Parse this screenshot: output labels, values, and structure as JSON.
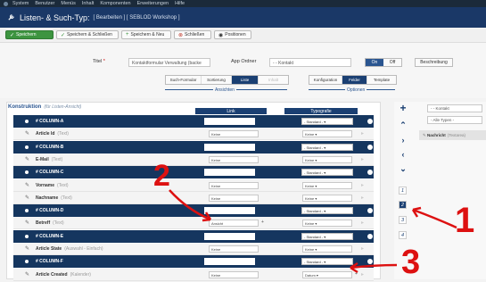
{
  "menu": [
    "System",
    "Benutzer",
    "Menüs",
    "Inhalt",
    "Komponenten",
    "Erweiterungen",
    "Hilfe"
  ],
  "title": {
    "main": "Listen- & Such-Typ:",
    "sub": "[ Bearbeiten ] [ SEBLOD Workshop ]"
  },
  "toolbar": {
    "save": "Speichern",
    "save_close": "Speichern & Schließen",
    "save_new": "Speichern & Neu",
    "close": "Schließen",
    "positions": "Positionen"
  },
  "form": {
    "title_label": "Titel",
    "title_req": "*",
    "title_value": "Kontaktformular Verwaltung (backe",
    "app_label": "App Ordner",
    "app_value": "- - Kontakt",
    "toggle_on": "On",
    "toggle_off": "Off",
    "description": "Beschreibung",
    "views": [
      "Such-Formular",
      "Sortierung",
      "Liste",
      "Inhalt"
    ],
    "views_label": "Ansichten",
    "options": [
      "Konfiguration",
      "Felder",
      "Template"
    ],
    "options_label": "Optionen"
  },
  "section": {
    "title": "Konstruktion",
    "hint": "(für Listen-Ansicht)",
    "col_link": "Link",
    "col_typo": "Typografie"
  },
  "rows": [
    {
      "name": "# COLUMN-A",
      "type": "",
      "dark": true,
      "link": "",
      "typo": "- Standard -"
    },
    {
      "name": "Article Id",
      "type": "(Text)",
      "dark": false,
      "link": "Keine",
      "typo": "Keine"
    },
    {
      "name": "# COLUMN-B",
      "type": "",
      "dark": true,
      "link": "",
      "typo": "- Standard -"
    },
    {
      "name": "E-Mail",
      "type": "(Text)",
      "dark": false,
      "link": "Keine",
      "typo": "Keine"
    },
    {
      "name": "# COLUMN-C",
      "type": "",
      "dark": true,
      "link": "",
      "typo": "- Standard -"
    },
    {
      "name": "Vorname",
      "type": "(Text)",
      "dark": false,
      "link": "Keine",
      "typo": "Keine"
    },
    {
      "name": "Nachname",
      "type": "(Text)",
      "dark": false,
      "link": "Keine",
      "typo": "Keine"
    },
    {
      "name": "# COLUMN-D",
      "type": "",
      "dark": true,
      "link": "",
      "typo": "- Standard -"
    },
    {
      "name": "Betreff",
      "type": "(Text)",
      "dark": false,
      "link": "Ansicht",
      "typo": "Keine"
    },
    {
      "name": "# COLUMN-E",
      "type": "",
      "dark": true,
      "link": "",
      "typo": "- Standard -"
    },
    {
      "name": "Article State",
      "type": "(Auswahl - Einfach)",
      "dark": false,
      "link": "Keine",
      "typo": "Keine"
    },
    {
      "name": "# COLUMN-F",
      "type": "",
      "dark": true,
      "link": "",
      "typo": "- Standard -"
    },
    {
      "name": "Article Created",
      "type": "(Kalender)",
      "dark": false,
      "link": "Keine",
      "typo": "Datum"
    }
  ],
  "right": {
    "filter1": "- - Kontakt",
    "filter2": "- Alle Typen -",
    "item_name": "Nachricht",
    "item_type": "(Textarea)",
    "pages": [
      "1",
      "2",
      "3",
      "4"
    ]
  },
  "annotations": [
    "1",
    "2",
    "3"
  ],
  "colors": {
    "brand": "#1a3867",
    "accent": "#2a5590",
    "save": "#3d9440",
    "annotation": "#dd1111"
  }
}
